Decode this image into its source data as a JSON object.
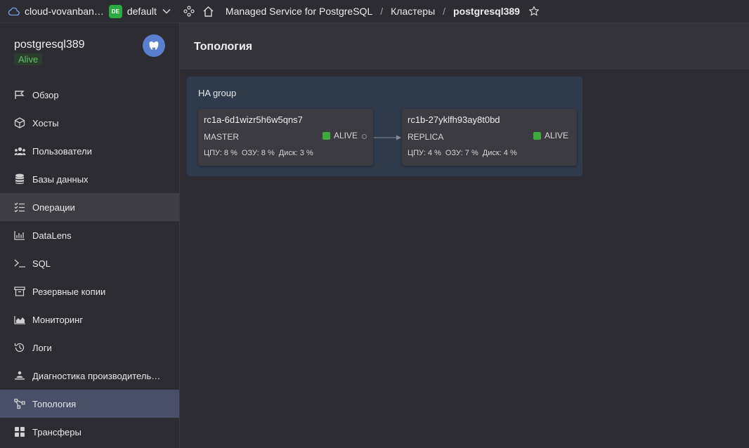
{
  "topbar": {
    "cloud_name": "cloud-vovanban…",
    "folder_badge": "DE",
    "folder_name": "default",
    "breadcrumbs": [
      "Managed Service for PostgreSQL",
      "Кластеры",
      "postgresql389"
    ],
    "separator": "/"
  },
  "cluster": {
    "name": "postgresql389",
    "status": "Alive"
  },
  "sidebar": {
    "items": [
      {
        "label": "Обзор",
        "icon": "flag-icon"
      },
      {
        "label": "Хосты",
        "icon": "cube-icon"
      },
      {
        "label": "Пользователи",
        "icon": "users-icon"
      },
      {
        "label": "Базы данных",
        "icon": "database-icon"
      },
      {
        "label": "Операции",
        "icon": "list-check-icon"
      },
      {
        "label": "DataLens",
        "icon": "chart-bars-icon"
      },
      {
        "label": "SQL",
        "icon": "terminal-icon"
      },
      {
        "label": "Резервные копии",
        "icon": "archive-icon"
      },
      {
        "label": "Мониторинг",
        "icon": "area-chart-icon"
      },
      {
        "label": "Логи",
        "icon": "history-icon"
      },
      {
        "label": "Диагностика производитель…",
        "icon": "person-desk-icon"
      },
      {
        "label": "Топология",
        "icon": "topology-icon"
      },
      {
        "label": "Трансферы",
        "icon": "transfer-icon"
      }
    ],
    "hover_index": 4,
    "active_index": 11
  },
  "page": {
    "title": "Топология"
  },
  "ha_group": {
    "title": "HA group",
    "hosts": [
      {
        "name": "rc1a-6d1wizr5h6w5qns7",
        "role": "MASTER",
        "status": "ALIVE",
        "cpu": "ЦПУ: 8 %",
        "ram": "ОЗУ: 8 %",
        "disk": "Диск: 3 %"
      },
      {
        "name": "rc1b-27yklfh93ay8t0bd",
        "role": "REPLICA",
        "status": "ALIVE",
        "cpu": "ЦПУ: 4 %",
        "ram": "ОЗУ: 7 %",
        "disk": "Диск: 4 %"
      }
    ]
  },
  "colors": {
    "accent": "#494f66",
    "alive": "#3eaa3b",
    "folder_badge": "#2bab3f",
    "avatar": "#5b7fcf"
  }
}
